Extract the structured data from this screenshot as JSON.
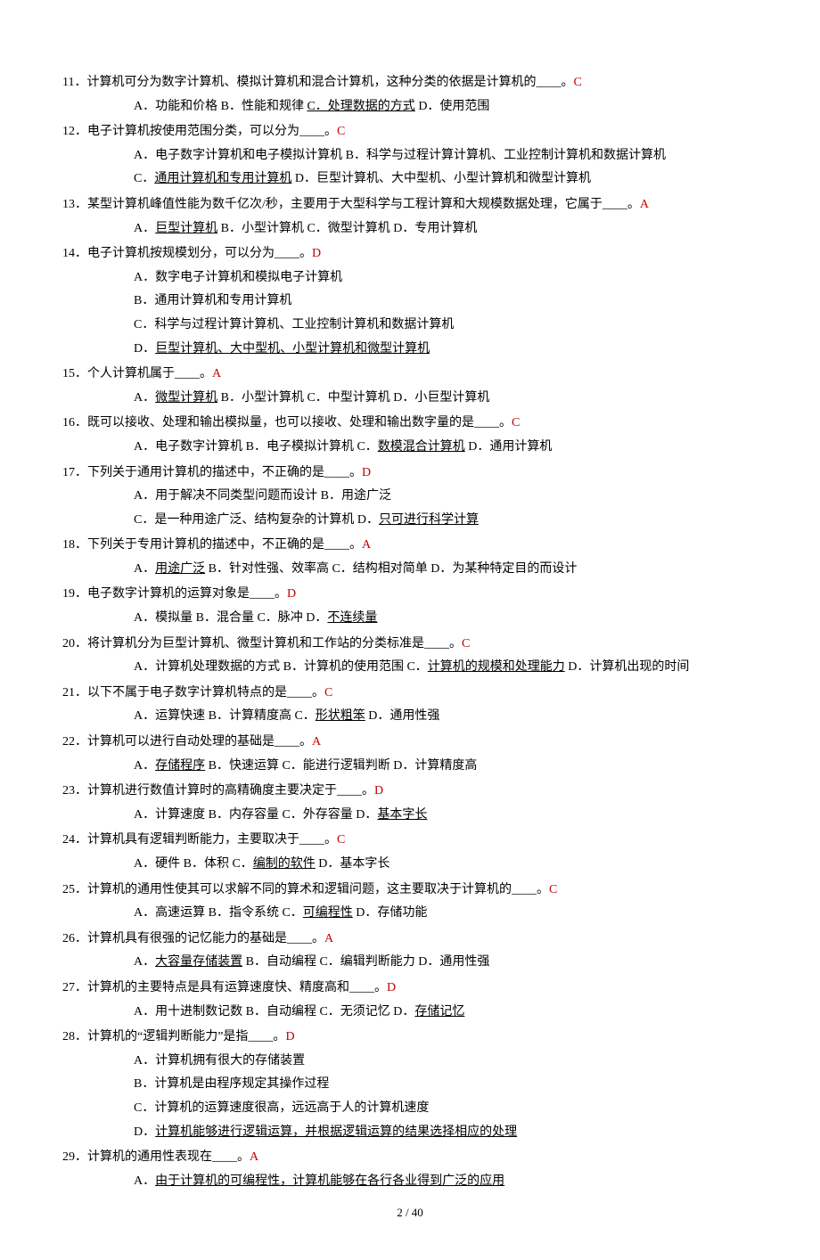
{
  "questions": [
    {
      "num": "11．",
      "stem": "计算机可分为数字计算机、模拟计算机和混合计算机，这种分类的依据是计算机的____。",
      "ans": "C",
      "opts": [
        [
          {
            "t": "A．功能和价格",
            "u": false
          },
          {
            "t": "  B．性能和规律  ",
            "u": false
          },
          {
            "t": "C．处理数据的方式",
            "u": true
          },
          {
            "t": "  D．使用范围",
            "u": false
          }
        ]
      ]
    },
    {
      "num": "12．",
      "stem": "电子计算机按使用范围分类，可以分为____。",
      "ans": "C",
      "opts": [
        [
          {
            "t": "A．电子数字计算机和电子模拟计算机  B．科学与过程计算计算机、工业控制计算机和数据计算机",
            "u": false
          }
        ],
        [
          {
            "t": "C．",
            "u": false
          },
          {
            "t": "通用计算机和专用计算机",
            "u": true
          },
          {
            "t": "  D．巨型计算机、大中型机、小型计算机和微型计算机",
            "u": false
          }
        ]
      ]
    },
    {
      "num": "13．",
      "stem": "某型计算机峰值性能为数千亿次/秒，主要用于大型科学与工程计算和大规模数据处理，它属于____。",
      "ans": "A",
      "opts": [
        [
          {
            "t": "A．",
            "u": false
          },
          {
            "t": "巨型计算机",
            "u": true
          },
          {
            "t": "  B．小型计算机  C．微型计算机  D．专用计算机",
            "u": false
          }
        ]
      ]
    },
    {
      "num": "14．",
      "stem": "电子计算机按规模划分，可以分为____。",
      "ans": "D",
      "opts": [
        [
          {
            "t": "A．数字电子计算机和模拟电子计算机",
            "u": false
          }
        ],
        [
          {
            "t": "B．通用计算机和专用计算机",
            "u": false
          }
        ],
        [
          {
            "t": "C．科学与过程计算计算机、工业控制计算机和数据计算机",
            "u": false
          }
        ],
        [
          {
            "t": "D．",
            "u": false
          },
          {
            "t": "巨型计算机、大中型机、小型计算机和微型计算机",
            "u": true
          }
        ]
      ]
    },
    {
      "num": "15．",
      "stem": "个人计算机属于____。",
      "ans": "A",
      "opts": [
        [
          {
            "t": "A．",
            "u": false
          },
          {
            "t": "微型计算机",
            "u": true
          },
          {
            "t": "  B．小型计算机  C．中型计算机  D．小巨型计算机",
            "u": false
          }
        ]
      ]
    },
    {
      "num": "16．",
      "stem": "既可以接收、处理和输出模拟量，也可以接收、处理和输出数字量的是____。",
      "ans": "C",
      "opts": [
        [
          {
            "t": "A．电子数字计算机  B．电子模拟计算机  C．",
            "u": false
          },
          {
            "t": "数模混合计算机",
            "u": true
          },
          {
            "t": "  D．通用计算机",
            "u": false
          }
        ]
      ]
    },
    {
      "num": "17．",
      "stem": "下列关于通用计算机的描述中，不正确的是____。",
      "ans": "D",
      "opts": [
        [
          {
            "t": "A．用于解决不同类型问题而设计  B．用途广泛",
            "u": false
          }
        ],
        [
          {
            "t": "C．是一种用途广泛、结构复杂的计算机  D．",
            "u": false
          },
          {
            "t": "只可进行科学计算",
            "u": true
          }
        ]
      ]
    },
    {
      "num": "18．",
      "stem": "下列关于专用计算机的描述中，不正确的是____。",
      "ans": "A",
      "opts": [
        [
          {
            "t": "A．",
            "u": false
          },
          {
            "t": "用途广泛",
            "u": true
          },
          {
            "t": "  B．针对性强、效率高  C．结构相对简单  D．为某种特定目的而设计",
            "u": false
          }
        ]
      ]
    },
    {
      "num": "19．",
      "stem": "电子数字计算机的运算对象是____。",
      "ans": "D",
      "opts": [
        [
          {
            "t": "A．模拟量  B．混合量  C．脉冲  D．",
            "u": false
          },
          {
            "t": "不连续量",
            "u": true
          }
        ]
      ]
    },
    {
      "num": "20．",
      "stem": "将计算机分为巨型计算机、微型计算机和工作站的分类标准是____。",
      "ans": "C",
      "opts": [
        [
          {
            "t": "A．计算机处理数据的方式  B．计算机的使用范围  C．",
            "u": false
          },
          {
            "t": "计算机的规模和处理能力",
            "u": true
          },
          {
            "t": "  D．计算机出现的时间",
            "u": false
          }
        ]
      ]
    },
    {
      "num": "21．",
      "stem": "以下不属于电子数字计算机特点的是____。",
      "ans": "C",
      "opts": [
        [
          {
            "t": "A．运算快速  B．计算精度高  C．",
            "u": false
          },
          {
            "t": "形状粗笨",
            "u": true
          },
          {
            "t": "  D．通用性强",
            "u": false
          }
        ]
      ]
    },
    {
      "num": "22．",
      "stem": "计算机可以进行自动处理的基础是____。",
      "ans": "A",
      "opts": [
        [
          {
            "t": "A．",
            "u": false
          },
          {
            "t": "存储程序",
            "u": true
          },
          {
            "t": "  B．快速运算  C．能进行逻辑判断  D．计算精度高",
            "u": false
          }
        ]
      ]
    },
    {
      "num": "23．",
      "stem": "计算机进行数值计算时的高精确度主要决定于____。",
      "ans": "D",
      "opts": [
        [
          {
            "t": "A．计算速度  B．内存容量  C．外存容量  D．",
            "u": false
          },
          {
            "t": "基本字长",
            "u": true
          }
        ]
      ]
    },
    {
      "num": "24．",
      "stem": "计算机具有逻辑判断能力，主要取决于____。",
      "ans": "C",
      "opts": [
        [
          {
            "t": "A．硬件  B．体积  C．",
            "u": false
          },
          {
            "t": "编制的软件",
            "u": true
          },
          {
            "t": "  D．基本字长",
            "u": false
          }
        ]
      ]
    },
    {
      "num": "25．",
      "stem": "计算机的通用性使其可以求解不同的算术和逻辑问题，这主要取决于计算机的____。",
      "ans": "C",
      "opts": [
        [
          {
            "t": "A．高速运算  B．指令系统  C．",
            "u": false
          },
          {
            "t": "可编程性",
            "u": true
          },
          {
            "t": "  D．存储功能",
            "u": false
          }
        ]
      ]
    },
    {
      "num": "26．",
      "stem": "计算机具有很强的记忆能力的基础是____。",
      "ans": "A",
      "opts": [
        [
          {
            "t": "A．",
            "u": false
          },
          {
            "t": "大容量存储装置",
            "u": true
          },
          {
            "t": "  B．自动编程  C．编辑判断能力  D．通用性强",
            "u": false
          }
        ]
      ]
    },
    {
      "num": "27．",
      "stem": "计算机的主要特点是具有运算速度快、精度高和____。",
      "ans": "D",
      "opts": [
        [
          {
            "t": "A．用十进制数记数  B．自动编程  C．无须记忆  D．",
            "u": false
          },
          {
            "t": "存储记忆",
            "u": true
          }
        ]
      ]
    },
    {
      "num": "28．",
      "stem": "计算机的“逻辑判断能力”是指____。",
      "ans": "D",
      "opts": [
        [
          {
            "t": "A．计算机拥有很大的存储装置",
            "u": false
          }
        ],
        [
          {
            "t": "B．计算机是由程序规定其操作过程",
            "u": false
          }
        ],
        [
          {
            "t": "C．计算机的运算速度很高，远远高于人的计算机速度",
            "u": false
          }
        ],
        [
          {
            "t": "D．",
            "u": false
          },
          {
            "t": "计算机能够进行逻辑运算，并根据逻辑运算的结果选择相应的处理",
            "u": true
          }
        ]
      ]
    },
    {
      "num": "29．",
      "stem": "计算机的通用性表现在____。",
      "ans": "A",
      "opts": [
        [
          {
            "t": "A．",
            "u": false
          },
          {
            "t": "由于计算机的可编程性，计算机能够在各行各业得到广泛的应用",
            "u": true
          }
        ]
      ]
    }
  ],
  "footer": "2 / 40"
}
